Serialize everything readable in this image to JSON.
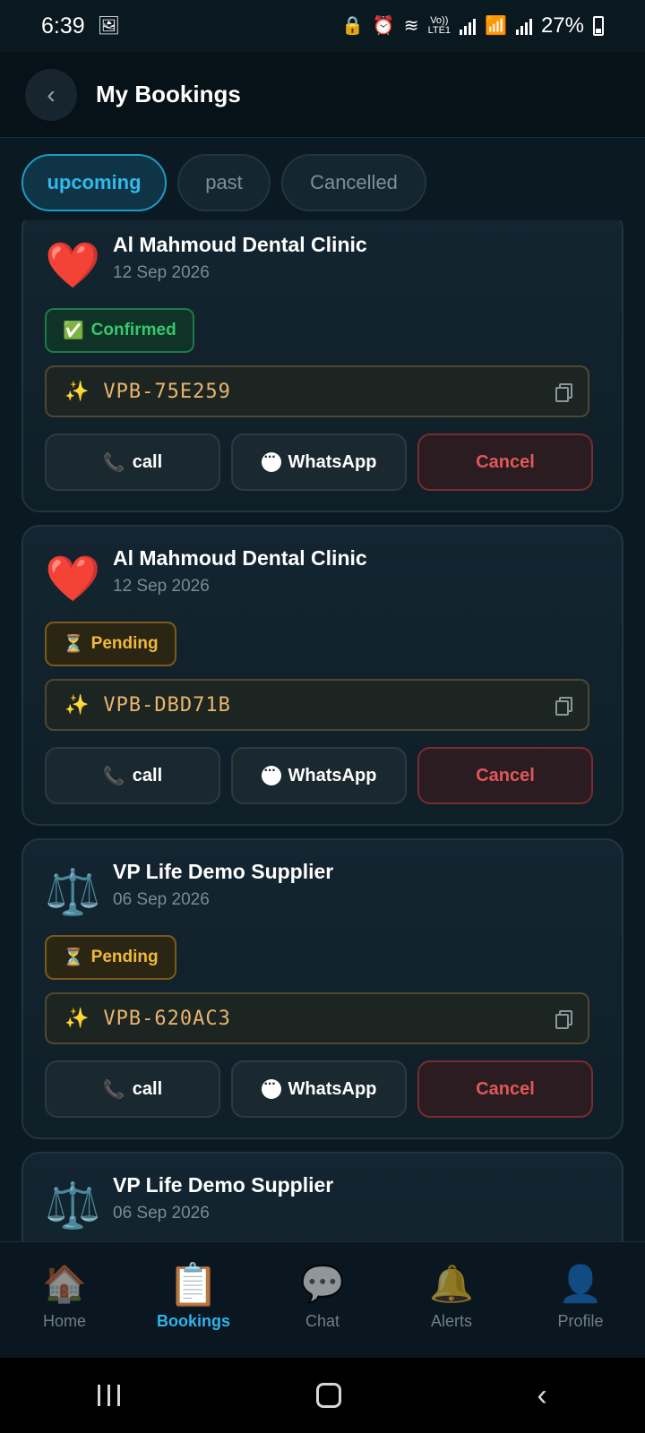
{
  "status_bar": {
    "time": "6:39",
    "battery": "27%",
    "network_label": "LTE1",
    "volte_label": "Vo))"
  },
  "header": {
    "title": "My Bookings",
    "back_glyph": "‹"
  },
  "tabs": [
    {
      "label": "upcoming",
      "active": true
    },
    {
      "label": "past",
      "active": false
    },
    {
      "label": "Cancelled",
      "active": false
    }
  ],
  "bookings": [
    {
      "emoji": "❤️",
      "name": "Al Mahmoud Dental Clinic",
      "date": "12 Sep 2026",
      "status_icon": "✅",
      "status": "Confirmed",
      "status_kind": "confirmed",
      "ref_icon": "✨",
      "ref": "VPB-75E259"
    },
    {
      "emoji": "❤️",
      "name": "Al Mahmoud Dental Clinic",
      "date": "12 Sep 2026",
      "status_icon": "⏳",
      "status": "Pending",
      "status_kind": "pending",
      "ref_icon": "✨",
      "ref": "VPB-DBD71B"
    },
    {
      "emoji": "⚖️",
      "name": "VP Life Demo Supplier",
      "date": "06 Sep 2026",
      "status_icon": "⏳",
      "status": "Pending",
      "status_kind": "pending",
      "ref_icon": "✨",
      "ref": "VPB-620AC3"
    },
    {
      "emoji": "⚖️",
      "name": "VP Life Demo Supplier",
      "date": "06 Sep 2026",
      "status_icon": "",
      "status": "",
      "status_kind": "",
      "ref_icon": "",
      "ref": ""
    }
  ],
  "actions": {
    "call_icon": "📞",
    "call_label": "call",
    "whatsapp_label": "WhatsApp",
    "cancel_label": "Cancel"
  },
  "bottom_nav": [
    {
      "icon": "🏠",
      "label": "Home",
      "active": false
    },
    {
      "icon": "📋",
      "label": "Bookings",
      "active": true
    },
    {
      "icon": "💬",
      "label": "Chat",
      "active": false
    },
    {
      "icon": "🔔",
      "label": "Alerts",
      "active": false
    },
    {
      "icon": "👤",
      "label": "Profile",
      "active": false
    }
  ],
  "colors": {
    "accent": "#2fb4ec",
    "confirmed": "#36c86e",
    "pending": "#f0b93a",
    "cancel": "#e0585a",
    "ref_code": "#e9b56b"
  }
}
